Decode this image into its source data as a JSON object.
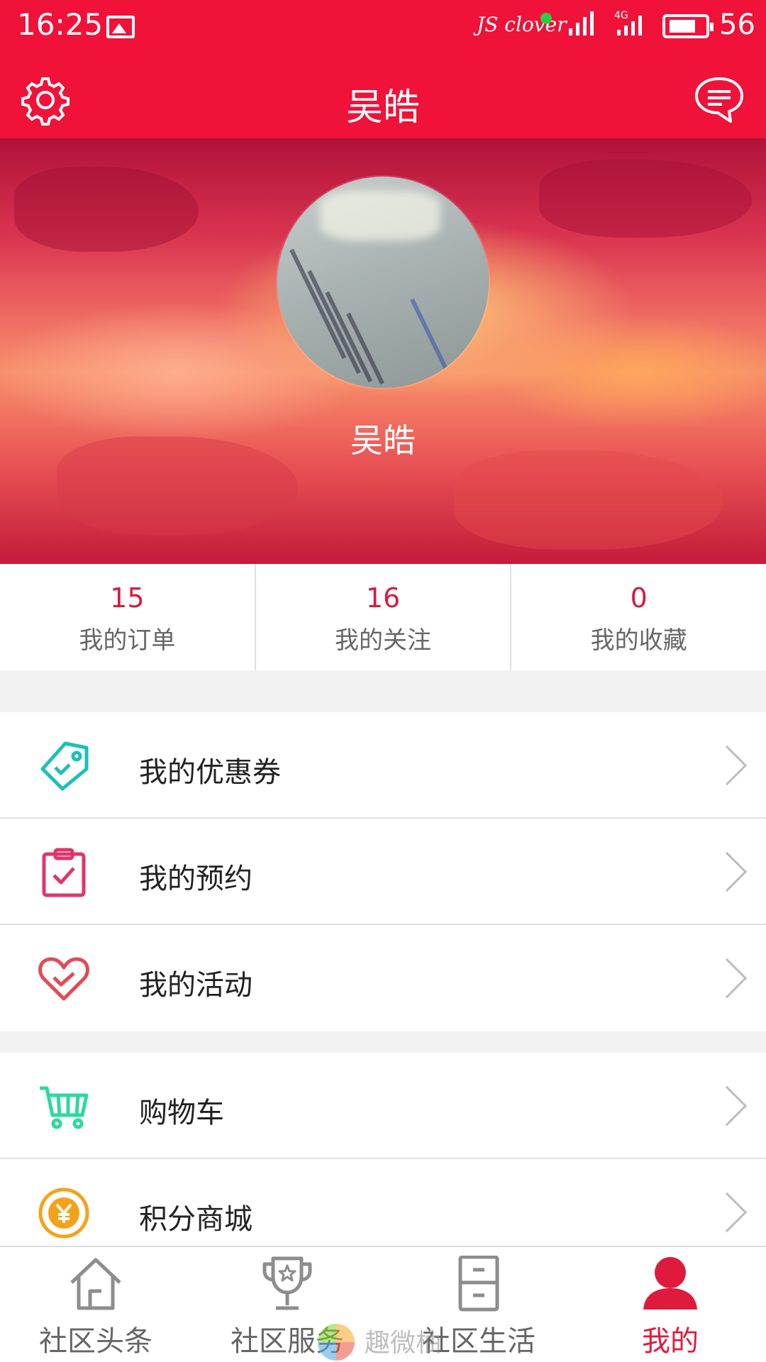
{
  "status_bar": {
    "time": "16:25",
    "carrier": "JS clover",
    "network": "4G",
    "battery": "56",
    "icons": [
      "image-icon",
      "signal-icon",
      "battery-icon"
    ]
  },
  "header": {
    "title": "吴皓",
    "left_icon": "gear-icon",
    "right_icon": "chat-bubble-icon"
  },
  "profile": {
    "name": "吴皓"
  },
  "stats": [
    {
      "value": "15",
      "label": "我的订单"
    },
    {
      "value": "16",
      "label": "我的关注"
    },
    {
      "value": "0",
      "label": "我的收藏"
    }
  ],
  "menu_group_1": [
    {
      "label": "我的优惠券",
      "icon": "coupon-tag-icon",
      "color": "#1fbfb8"
    },
    {
      "label": "我的预约",
      "icon": "clipboard-check-icon",
      "color": "#e0356b"
    },
    {
      "label": "我的活动",
      "icon": "heart-check-icon",
      "color": "#e24a55"
    }
  ],
  "menu_group_2": [
    {
      "label": "购物车",
      "icon": "shopping-cart-icon",
      "color": "#2ed8a0"
    },
    {
      "label": "积分商城",
      "icon": "yen-coin-icon",
      "color": "#f5a21b"
    }
  ],
  "bottom_nav": [
    {
      "label": "社区头条",
      "icon": "house-icon",
      "active": false
    },
    {
      "label": "社区服务",
      "icon": "trophy-icon",
      "active": false
    },
    {
      "label": "社区生活",
      "icon": "cabinet-icon",
      "active": false
    },
    {
      "label": "我的",
      "icon": "person-icon",
      "active": true
    }
  ],
  "watermark": "趣微柚",
  "colors": {
    "brand": "#f01239",
    "stat_number": "#d61b3f",
    "nav_active": "#e01a3c"
  }
}
